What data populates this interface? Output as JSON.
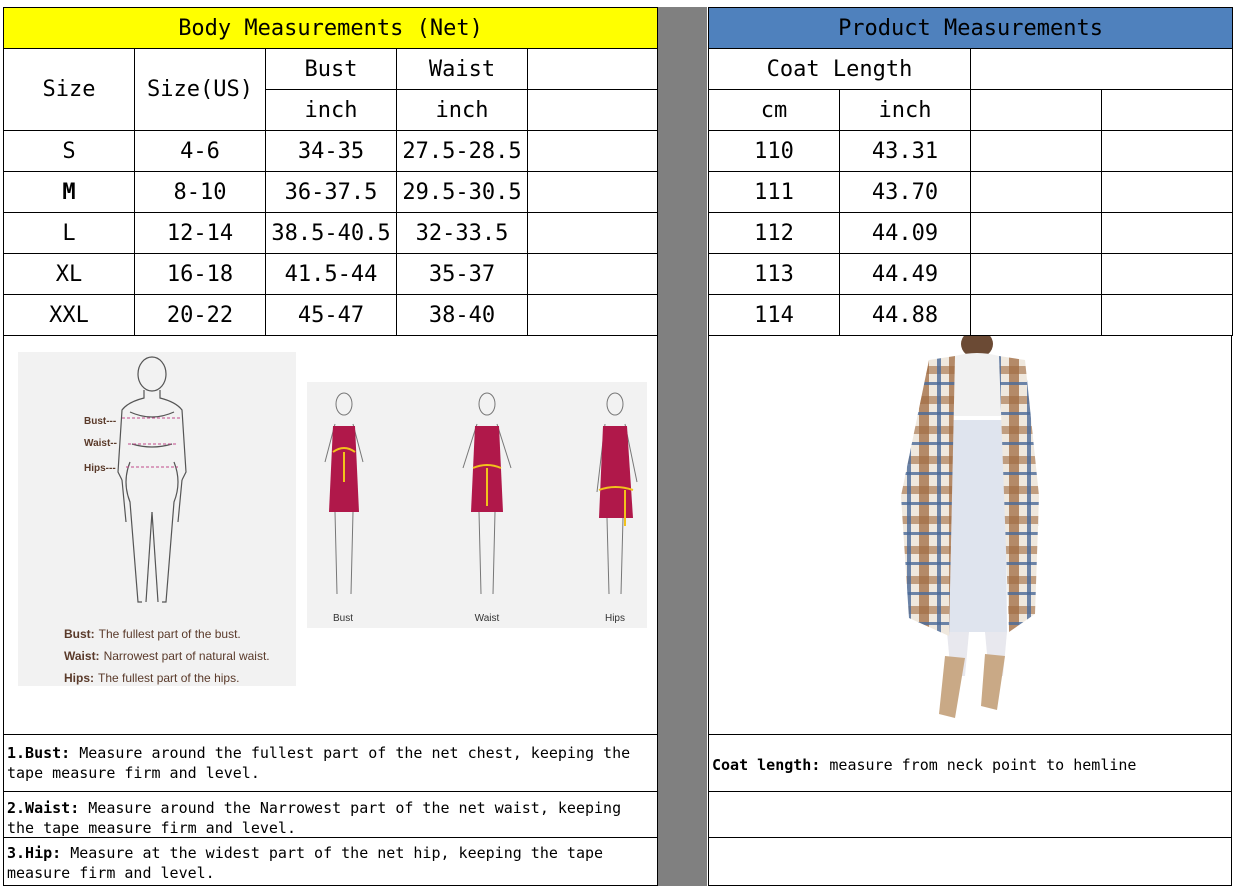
{
  "left": {
    "title": "Body Measurements (Net)",
    "columns": {
      "size": "Size",
      "size_us": "Size(US)",
      "bust": "Bust",
      "waist": "Waist",
      "bust_unit": "inch",
      "waist_unit": "inch"
    },
    "rows": [
      {
        "size": "S",
        "us": "4-6",
        "bust": "34-35",
        "waist": "27.5-28.5"
      },
      {
        "size": "M",
        "us": "8-10",
        "bust": "36-37.5",
        "waist": "29.5-30.5"
      },
      {
        "size": "L",
        "us": "12-14",
        "bust": "38.5-40.5",
        "waist": "32-33.5"
      },
      {
        "size": "XL",
        "us": "16-18",
        "bust": "41.5-44",
        "waist": "35-37"
      },
      {
        "size": "XXL",
        "us": "20-22",
        "bust": "45-47",
        "waist": "38-40"
      }
    ],
    "figure1": {
      "bust_mark": "Bust---",
      "waist_mark": "Waist--",
      "hips_mark": "Hips---",
      "legend": [
        {
          "term": "Bust:",
          "desc": "The fullest part of the bust."
        },
        {
          "term": "Waist:",
          "desc": "Narrowest part of natural waist."
        },
        {
          "term": "Hips:",
          "desc": "The fullest part of the hips."
        }
      ]
    },
    "figure2": {
      "labels": [
        "Bust",
        "Waist",
        "Hips"
      ]
    },
    "notes": [
      {
        "term": "1.Bust:",
        "text": "  Measure around the fullest part of the net chest, keeping the tape  measure firm and level."
      },
      {
        "term": "2.Waist:",
        "text": " Measure around the Narrowest part of the net waist, keeping the tape  measure firm and level."
      },
      {
        "term": "3.Hip:",
        "text": " Measure at the widest part of the net hip, keeping the tape measure firm and level."
      }
    ]
  },
  "right": {
    "title": "Product Measurements",
    "column": "Coat Length",
    "unit_cm": "cm",
    "unit_inch": "inch",
    "rows": [
      {
        "cm": "110",
        "inch": "43.31"
      },
      {
        "cm": "111",
        "inch": "43.70"
      },
      {
        "cm": "112",
        "inch": "44.09"
      },
      {
        "cm": "113",
        "inch": "44.49"
      },
      {
        "cm": "114",
        "inch": "44.88"
      }
    ],
    "note": {
      "term": "Coat length:",
      "text": " measure from neck point to hemline"
    }
  },
  "colors": {
    "left_header": "#ffff00",
    "right_header": "#4f81bd",
    "divider": "#808080",
    "dress": "#b0184a",
    "tape": "#f2c21b"
  }
}
